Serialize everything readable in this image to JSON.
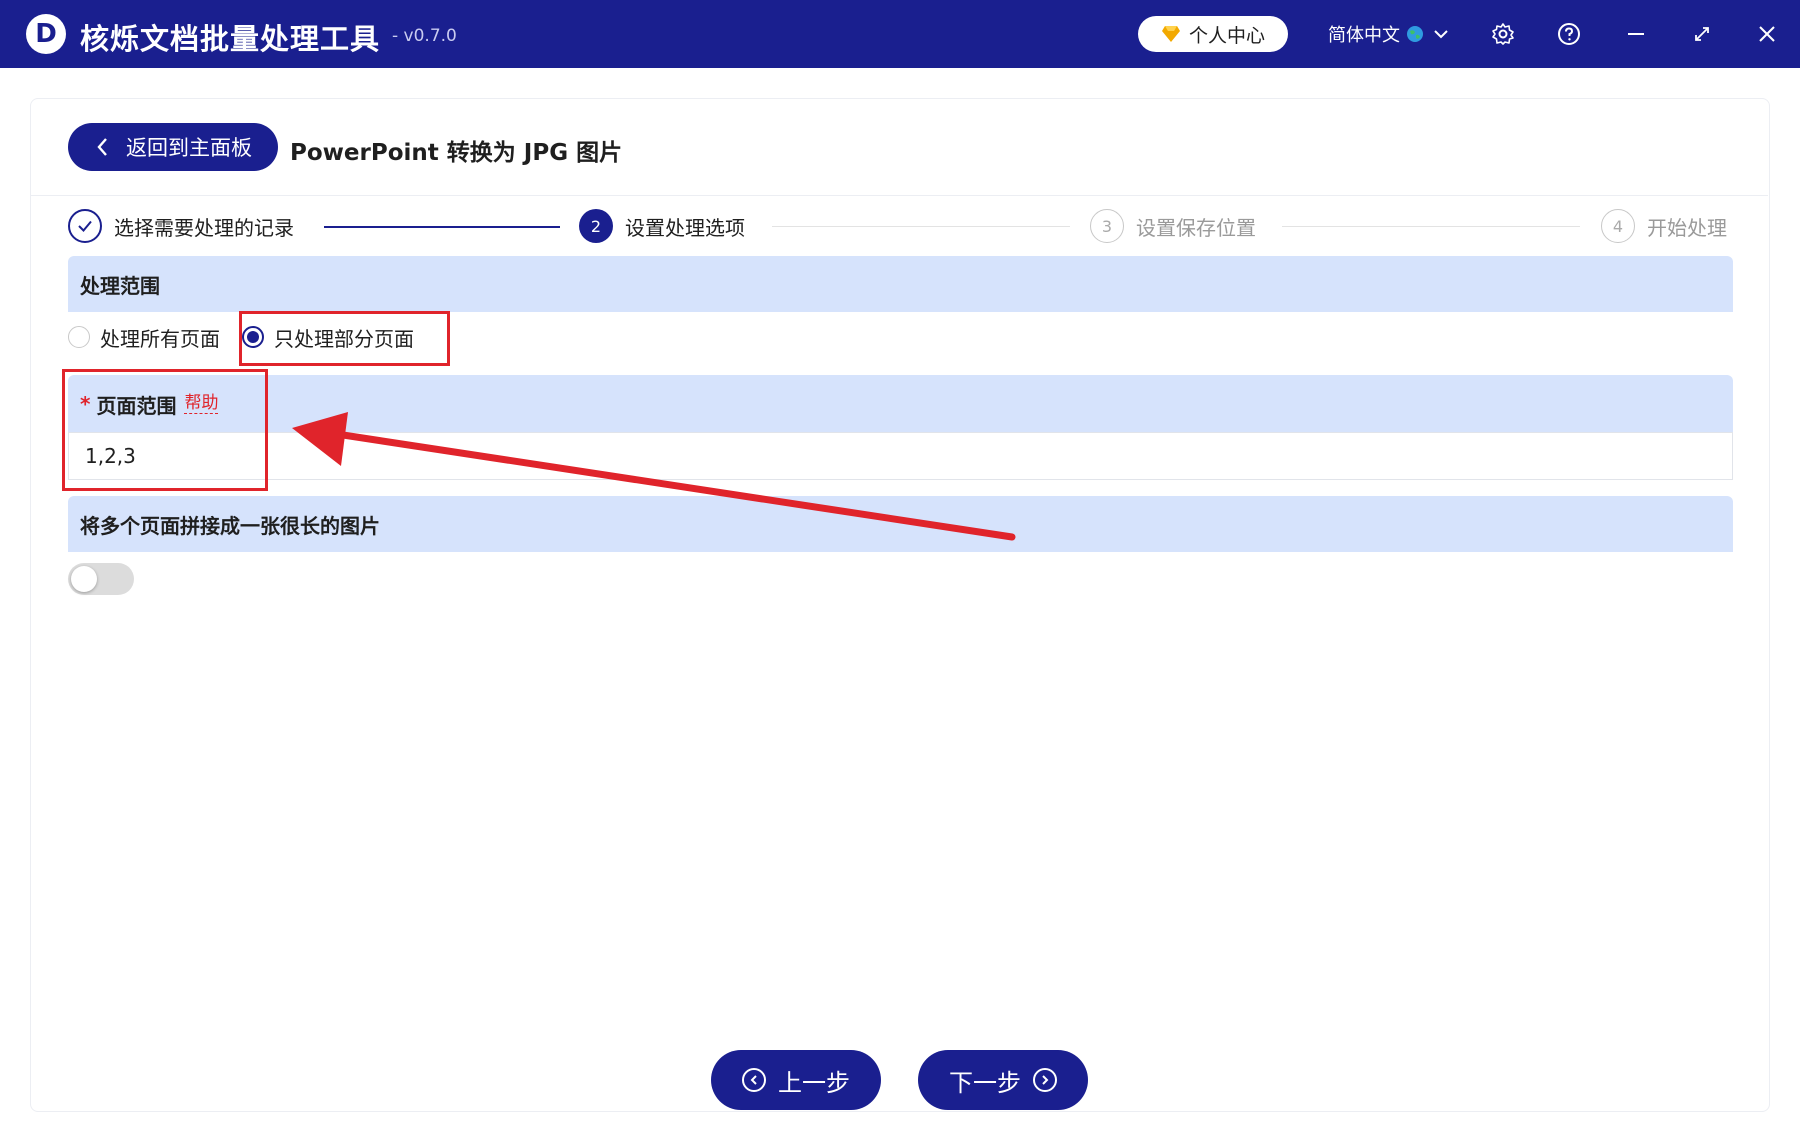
{
  "app": {
    "logo_letter": "D",
    "title": "核烁文档批量处理工具",
    "version": "- v0.7.0",
    "user_center": "个人中心",
    "language": "简体中文"
  },
  "colors": {
    "primary": "#1a1f8f",
    "section_bg": "#d6e3fc",
    "highlight_red": "#e0242b",
    "gem_gold": "#f2a900"
  },
  "header": {
    "back_label": "返回到主面板",
    "page_title": "PowerPoint 转换为 JPG 图片"
  },
  "steps": [
    {
      "num": "1",
      "label": "选择需要处理的记录",
      "state": "done"
    },
    {
      "num": "2",
      "label": "设置处理选项",
      "state": "active"
    },
    {
      "num": "3",
      "label": "设置保存位置",
      "state": "todo"
    },
    {
      "num": "4",
      "label": "开始处理",
      "state": "todo"
    }
  ],
  "scope": {
    "title": "处理范围",
    "option_all": "处理所有页面",
    "option_partial": "只处理部分页面",
    "selected": "option_partial"
  },
  "page_range": {
    "required_mark": "*",
    "title": "页面范围",
    "help": "帮助",
    "value": "1,2,3"
  },
  "merge": {
    "title": "将多个页面拼接成一张很长的图片",
    "enabled": false
  },
  "footer": {
    "prev_label": "上一步",
    "next_label": "下一步"
  }
}
